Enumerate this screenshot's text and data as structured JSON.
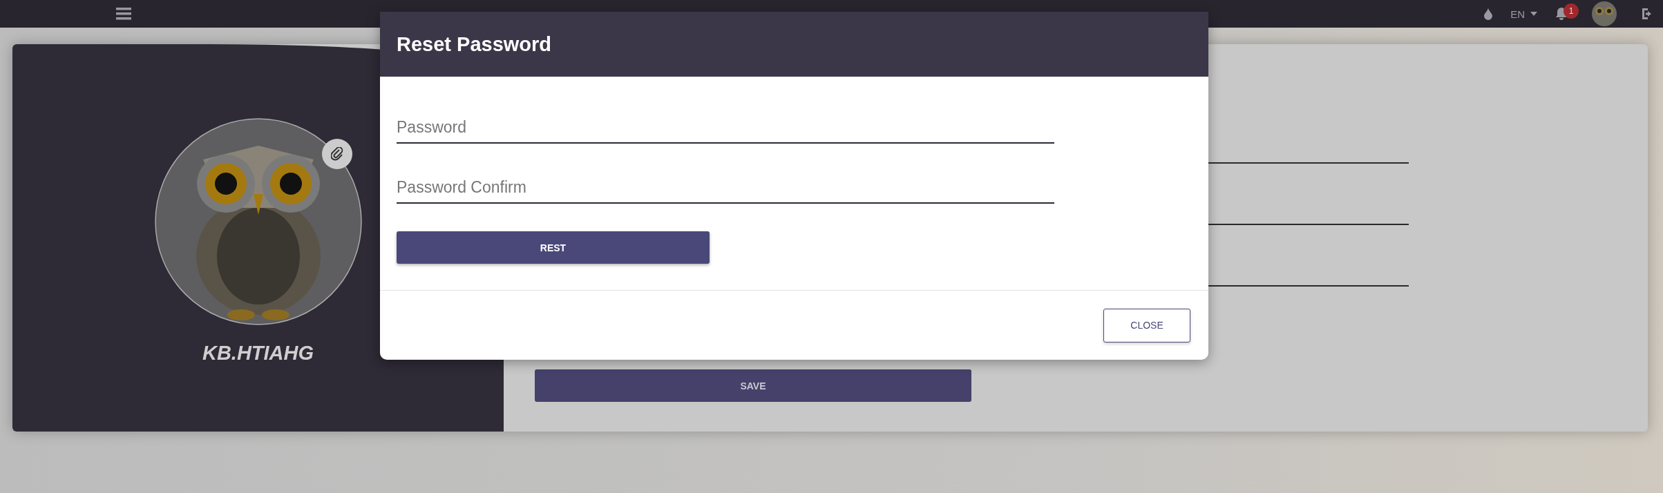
{
  "top_bar": {
    "language": "EN",
    "notification_count": "1"
  },
  "profile": {
    "name": "KB.HTIAHG"
  },
  "profile_form": {
    "save_button": "SAVE"
  },
  "dialog": {
    "title": "Reset Password",
    "fields": [
      {
        "placeholder": "Password"
      },
      {
        "placeholder": "Password Confirm"
      }
    ],
    "submit_button": "REST",
    "close_button": "CLOSE"
  }
}
